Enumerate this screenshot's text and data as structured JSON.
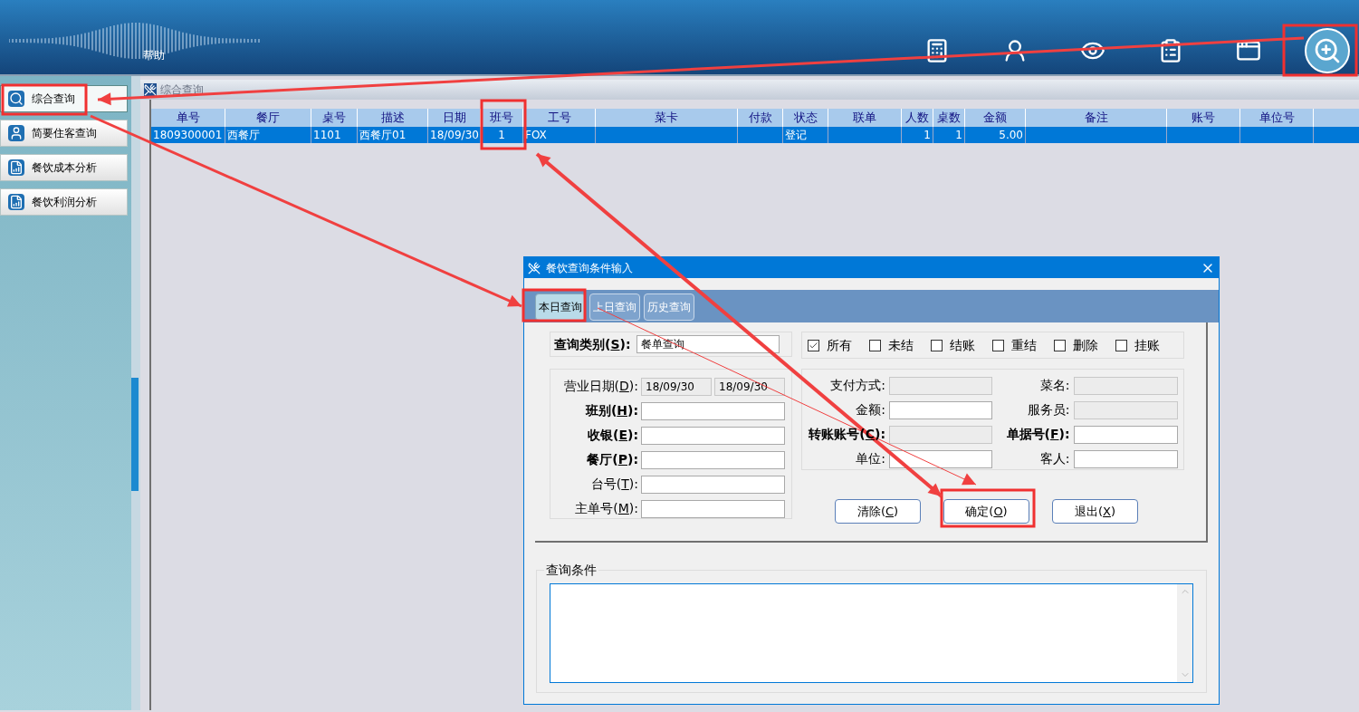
{
  "header": {
    "help_label": "帮助"
  },
  "sidebar": {
    "items": [
      {
        "label": "综合查询",
        "kind": "search",
        "selected": true
      },
      {
        "label": "简要住客查询",
        "kind": "person",
        "selected": false
      },
      {
        "label": "餐饮成本分析",
        "kind": "report",
        "selected": false
      },
      {
        "label": "餐饮利润分析",
        "kind": "report",
        "selected": false
      }
    ]
  },
  "panel": {
    "title": "综合查询"
  },
  "table": {
    "columns": [
      "单号",
      "餐厅",
      "桌号",
      "描述",
      "日期",
      "班号",
      "工号",
      "菜卡",
      "付款",
      "状态",
      "联单",
      "人数",
      "桌数",
      "金额",
      "备注",
      "账号",
      "单位号"
    ],
    "rows": [
      {
        "selected": true,
        "cells": [
          "1809300001",
          "西餐厅",
          "1101",
          "西餐厅01",
          "18/09/30",
          "1",
          "FOX",
          null,
          null,
          "登记",
          null,
          "1",
          "1",
          "5.00",
          null,
          null,
          null
        ]
      }
    ]
  },
  "dialog": {
    "title": "餐饮查询条件输入",
    "tabs": [
      {
        "label": "本日查询",
        "selected": true
      },
      {
        "label": "上日查询",
        "selected": false
      },
      {
        "label": "历史查询",
        "selected": false
      }
    ],
    "query_type": {
      "label": "查询类别(",
      "key": "S",
      "suffix": "):",
      "value": "餐单查询"
    },
    "statuses": [
      {
        "label": "所有",
        "checked": true
      },
      {
        "label": "未结",
        "checked": false
      },
      {
        "label": "结账",
        "checked": false
      },
      {
        "label": "重结",
        "checked": false
      },
      {
        "label": "删除",
        "checked": false
      },
      {
        "label": "挂账",
        "checked": false
      }
    ],
    "left_fields": [
      {
        "label": "营业日期(",
        "key": "D",
        "suffix": "):",
        "bold": false,
        "kind": "range",
        "values": [
          "18/09/30",
          "18/09/30"
        ],
        "disabled": true
      },
      {
        "label": "班别(",
        "key": "H",
        "suffix": "):",
        "bold": true,
        "kind": "text",
        "disabled": false
      },
      {
        "label": "收银(",
        "key": "E",
        "suffix": "):",
        "bold": true,
        "kind": "text",
        "disabled": false
      },
      {
        "label": "餐厅(",
        "key": "P",
        "suffix": "):",
        "bold": true,
        "kind": "text",
        "disabled": false
      },
      {
        "label": "台号(",
        "key": "T",
        "suffix": "):",
        "bold": false,
        "kind": "text",
        "disabled": false
      },
      {
        "label": "主单号(",
        "key": "M",
        "suffix": "):",
        "bold": false,
        "kind": "text",
        "disabled": false
      }
    ],
    "right_fields": [
      {
        "label": "支付方式:",
        "bold": false,
        "disabled": true
      },
      {
        "label": "菜名:",
        "bold": false,
        "disabled": true
      },
      {
        "label": "金额:",
        "bold": false,
        "disabled": false
      },
      {
        "label": "服务员:",
        "bold": false,
        "disabled": true
      },
      {
        "label": "转账账号(",
        "key": "C",
        "suffix": "):",
        "bold": true,
        "disabled": true
      },
      {
        "label": "单据号(",
        "key": "F",
        "suffix": "):",
        "bold": true,
        "disabled": false
      },
      {
        "label": "单位:",
        "bold": false,
        "disabled": false
      },
      {
        "label": "客人:",
        "bold": false,
        "disabled": false
      }
    ],
    "buttons": [
      {
        "label": "清除(",
        "key": "C",
        "suffix": ")"
      },
      {
        "label": "确定(",
        "key": "O",
        "suffix": ")"
      },
      {
        "label": "退出(",
        "key": "X",
        "suffix": ")"
      }
    ],
    "conditions": {
      "legend": "查询条件"
    }
  }
}
